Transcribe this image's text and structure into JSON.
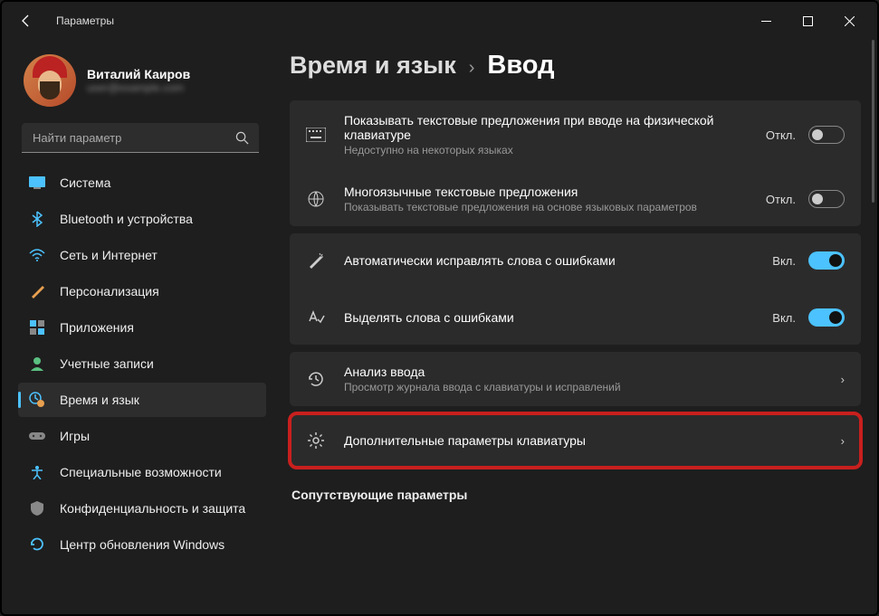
{
  "window": {
    "title": "Параметры"
  },
  "profile": {
    "name": "Виталий Каиров",
    "email": "user@example.com"
  },
  "search": {
    "placeholder": "Найти параметр"
  },
  "sidebar": {
    "items": [
      {
        "label": "Система"
      },
      {
        "label": "Bluetooth и устройства"
      },
      {
        "label": "Сеть и Интернет"
      },
      {
        "label": "Персонализация"
      },
      {
        "label": "Приложения"
      },
      {
        "label": "Учетные записи"
      },
      {
        "label": "Время и язык"
      },
      {
        "label": "Игры"
      },
      {
        "label": "Специальные возможности"
      },
      {
        "label": "Конфиденциальность и защита"
      },
      {
        "label": "Центр обновления Windows"
      }
    ]
  },
  "breadcrumb": {
    "parent": "Время и язык",
    "sep": "›",
    "current": "Ввод"
  },
  "settings": {
    "textSuggestions": {
      "title": "Показывать текстовые предложения при вводе на физической клавиатуре",
      "sub": "Недоступно на некоторых языках",
      "state": "Откл."
    },
    "multilingual": {
      "title": "Многоязычные текстовые предложения",
      "sub": "Показывать текстовые предложения на основе языковых параметров",
      "state": "Откл."
    },
    "autocorrect": {
      "title": "Автоматически исправлять слова с ошибками",
      "state": "Вкл."
    },
    "highlight": {
      "title": "Выделять слова с ошибками",
      "state": "Вкл."
    },
    "inputAnalysis": {
      "title": "Анализ ввода",
      "sub": "Просмотр журнала ввода с клавиатуры и исправлений"
    },
    "keyboardSettings": {
      "title": "Дополнительные параметры клавиатуры"
    }
  },
  "related": {
    "heading": "Сопутствующие параметры"
  }
}
